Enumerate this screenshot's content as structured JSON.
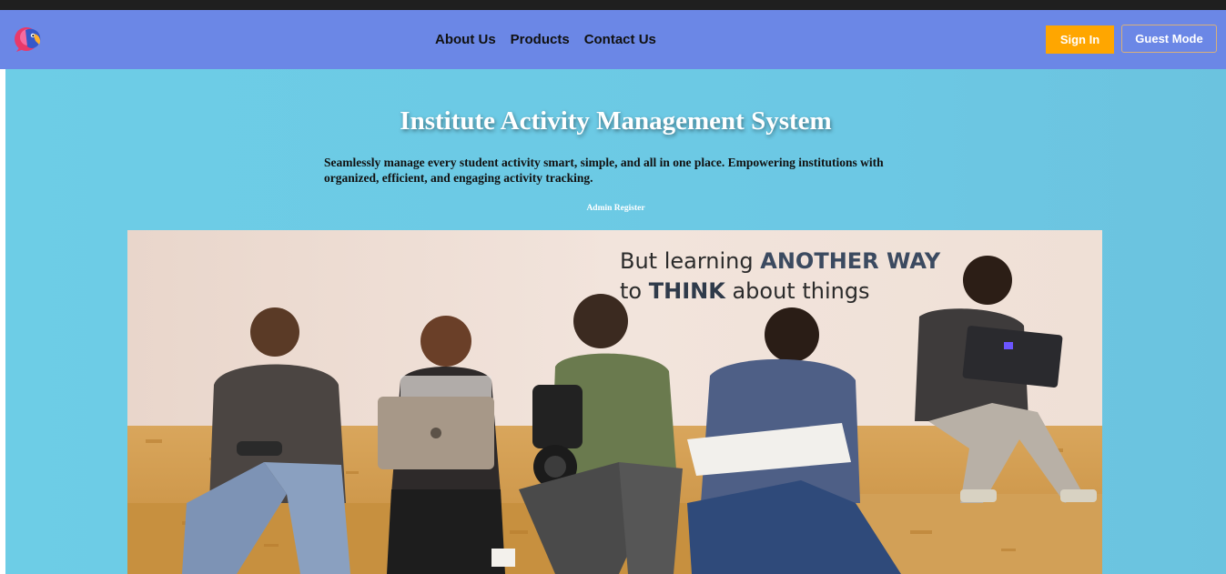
{
  "navbar": {
    "logo_icon": "parrot-logo-icon",
    "links": [
      {
        "label": "About Us"
      },
      {
        "label": "Products"
      },
      {
        "label": "Contact Us"
      }
    ],
    "signin_label": "Sign In",
    "guest_label": "Guest Mode"
  },
  "hero": {
    "title": "Institute Activity Management System",
    "description": "Seamlessly manage every student activity smart, simple, and all in one place. Empowering institutions with organized, efficient, and engaging activity tracking.",
    "admin_register_label": "Admin Register",
    "image": {
      "caption_line1_prefix": "But learning ",
      "caption_line1_bold": "ANOTHER WAY",
      "caption_line2_prefix": "to ",
      "caption_line2_bold": "THINK",
      "caption_line2_suffix": " about things"
    }
  },
  "colors": {
    "topstrip": "#1f1f1f",
    "navbar": "#6b87e6",
    "signin": "#ffa600",
    "hero_bg": "#6dcde6"
  }
}
